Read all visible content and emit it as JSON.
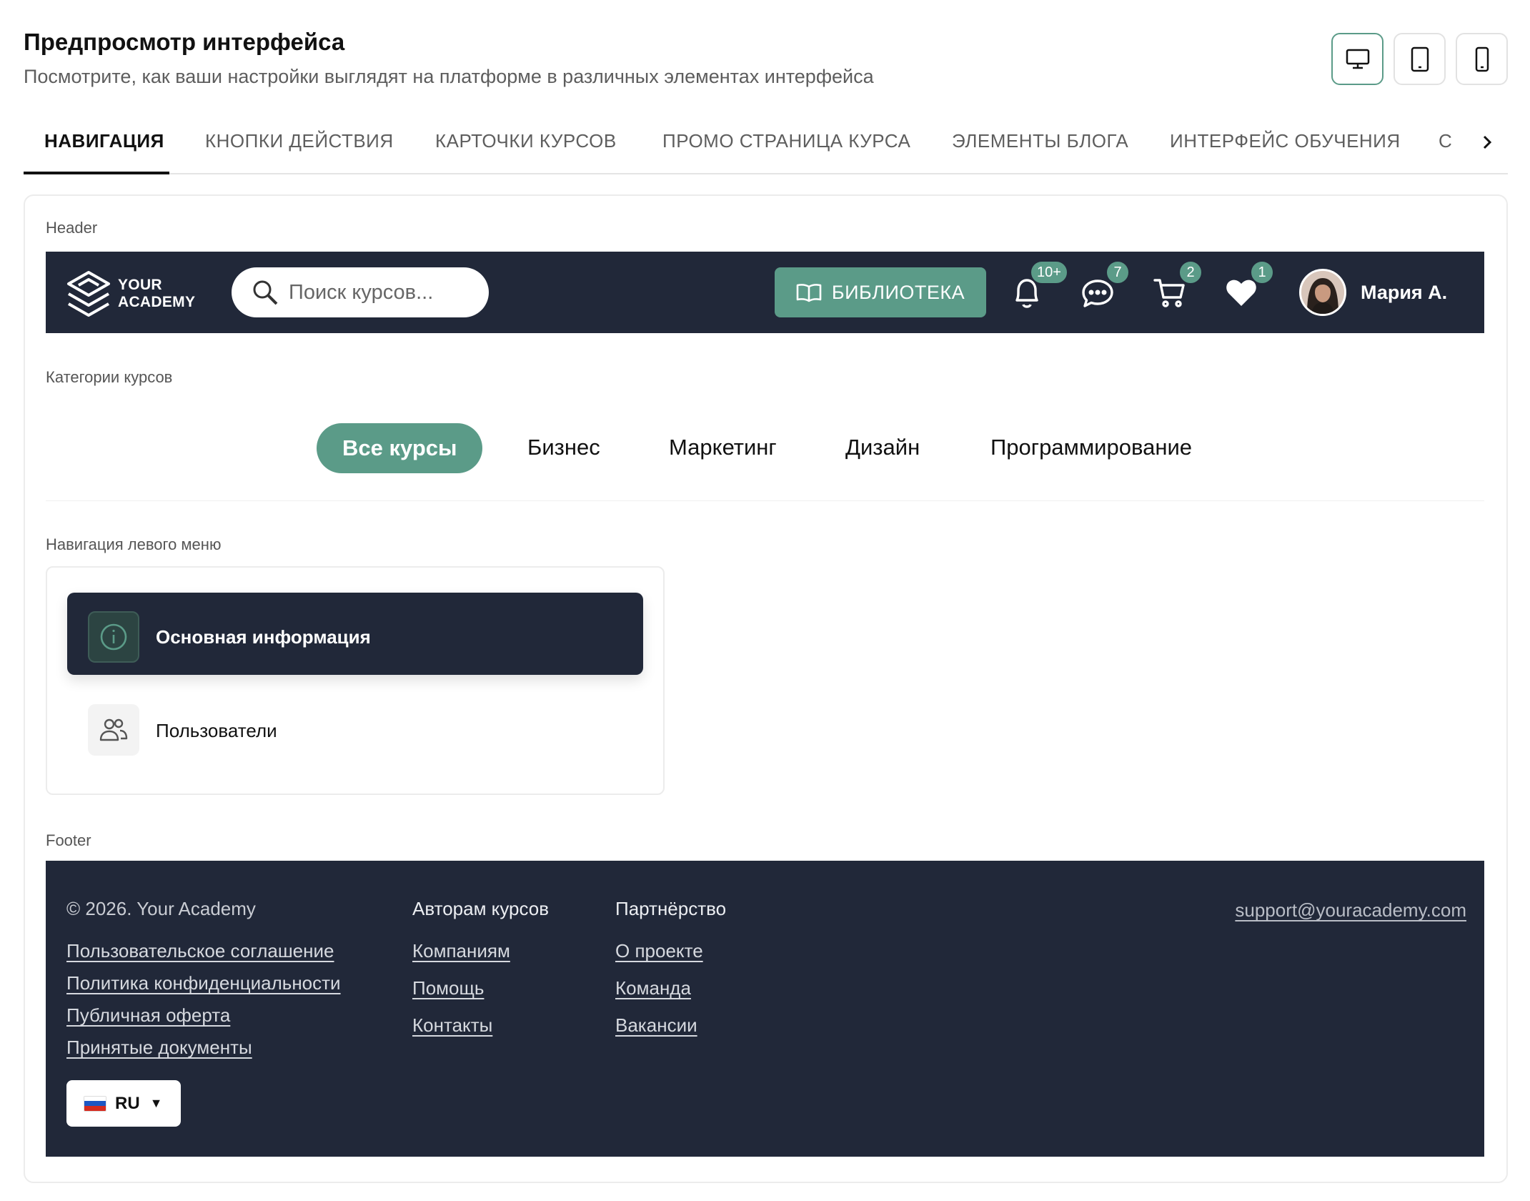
{
  "page": {
    "title": "Предпросмотр интерфейса",
    "subtitle": "Посмотрите, как ваши настройки выглядят на платформе в различных элементах интерфейса"
  },
  "device_toggle": {
    "selected": "desktop",
    "options": [
      "desktop",
      "tablet",
      "mobile"
    ],
    "icons": [
      "desktop-icon",
      "tablet-icon",
      "mobile-icon"
    ]
  },
  "tabs": [
    {
      "label": "НАВИГАЦИЯ",
      "active": true
    },
    {
      "label": "КНОПКИ ДЕЙСТВИЯ"
    },
    {
      "label": "КАРТОЧКИ КУРСОВ"
    },
    {
      "label": "ПРОМО СТРАНИЦА КУРСА"
    },
    {
      "label": "ЭЛЕМЕНТЫ БЛОГА"
    },
    {
      "label": "ИНТЕРФЕЙС ОБУЧЕНИЯ"
    },
    {
      "label": "С"
    }
  ],
  "sections": {
    "header": "Header",
    "categories": "Категории курсов",
    "left_menu": "Навигация левого меню",
    "footer": "Footer"
  },
  "header": {
    "logo_line1": "YOUR",
    "logo_line2": "ACADEMY",
    "search_placeholder": "Поиск курсов...",
    "library_label": "БИБЛИОТЕКА",
    "badges": {
      "notifications": "10+",
      "messages": "7",
      "cart": "2",
      "favorites": "1"
    },
    "user_name": "Мария А."
  },
  "categories": [
    {
      "label": "Все курсы",
      "active": true
    },
    {
      "label": "Бизнес"
    },
    {
      "label": "Маркетинг"
    },
    {
      "label": "Дизайн"
    },
    {
      "label": "Программирование"
    }
  ],
  "left_menu": [
    {
      "label": "Основная информация",
      "icon": "info-icon",
      "active": true
    },
    {
      "label": "Пользователи",
      "icon": "users-icon"
    }
  ],
  "footer": {
    "copyright": "© 2026. Your Academy",
    "col1_links": [
      "Пользовательское соглашение",
      "Политика конфиденциальности",
      "Публичная оферта",
      "Принятые документы"
    ],
    "col2_title": "Авторам курсов",
    "col2_links": [
      "Компаниям",
      "Помощь",
      "Контакты"
    ],
    "col3_title": "Партнёрство",
    "col3_links": [
      "О проекте",
      "Команда",
      "Вакансии"
    ],
    "email": "support@youracademy.com",
    "language": "RU"
  },
  "colors": {
    "accent": "#5b9b88",
    "dark": "#212839",
    "border": "#ececec"
  }
}
